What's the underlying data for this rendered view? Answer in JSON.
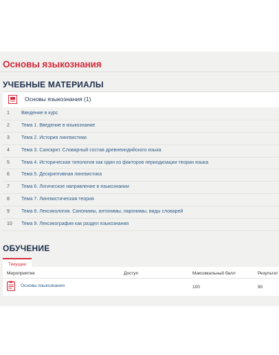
{
  "page": {
    "title": "Основы языкознания"
  },
  "materials": {
    "section_title": "УЧЕБНЫЕ МАТЕРИАЛЫ",
    "course_title": "Основы языкознания (1)",
    "topics": [
      {
        "num": "1",
        "text": "Введение в курс"
      },
      {
        "num": "2",
        "text": "Тема 1. Введение в языкознание"
      },
      {
        "num": "3",
        "text": "Тема 2. История лингвистики"
      },
      {
        "num": "4",
        "text": "Тема 3. Санскрит. Словарный состав древнеиндийского языка"
      },
      {
        "num": "5",
        "text": "Тема 4. Историческая типология как один из факторов периодизации теории языка"
      },
      {
        "num": "6",
        "text": "Тема 5. Дескриптивная лингвистика"
      },
      {
        "num": "7",
        "text": "Тема 6. Логическое направление в языкознании"
      },
      {
        "num": "8",
        "text": "Тема 7. Лингвистическая теория"
      },
      {
        "num": "9",
        "text": "Тема 8. Лексикология. Синонимы, антонимы, паронимы, виды словарей"
      },
      {
        "num": "10",
        "text": "Тема 9. Лексикография как раздел языкознания"
      }
    ]
  },
  "learning": {
    "section_title": "ОБУЧЕНИЕ",
    "tab_label": "Текущие",
    "columns": [
      "Мероприятие",
      "Доступ",
      "Максимальный балл",
      "Результат"
    ],
    "rows": [
      {
        "event": "Основы языкознания",
        "access": "",
        "max_score": "100",
        "result": "90"
      }
    ]
  },
  "colors": {
    "accent": "#d42a3b",
    "heading": "#1d2e4a",
    "link": "#2f5d8a"
  }
}
